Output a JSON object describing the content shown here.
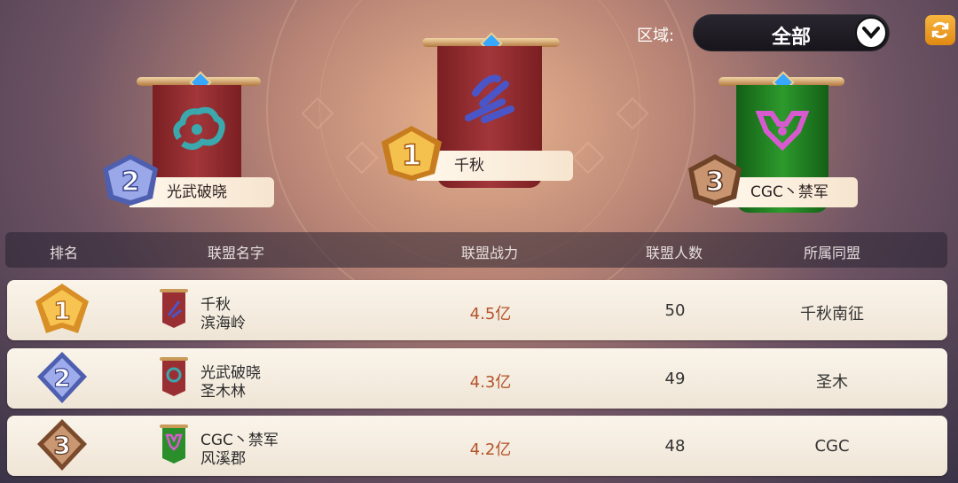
{
  "region": {
    "label": "区域:",
    "value": "全部"
  },
  "podium": [
    {
      "rank": "1",
      "name": "千秋",
      "color": "red"
    },
    {
      "rank": "2",
      "name": "光武破晓",
      "color": "red"
    },
    {
      "rank": "3",
      "name": "CGC丶禁军",
      "color": "green"
    }
  ],
  "table": {
    "headers": [
      "排名",
      "联盟名字",
      "联盟战力",
      "联盟人数",
      "所属同盟"
    ],
    "rows": [
      {
        "rank": "1",
        "name": "千秋",
        "server": "滨海岭",
        "power": "4.5亿",
        "members": "50",
        "alliance": "千秋南征"
      },
      {
        "rank": "2",
        "name": "光武破晓",
        "server": "圣木林",
        "power": "4.3亿",
        "members": "49",
        "alliance": "圣木"
      },
      {
        "rank": "3",
        "name": "CGC丶禁军",
        "server": "风溪郡",
        "power": "4.2亿",
        "members": "48",
        "alliance": "CGC"
      }
    ]
  },
  "colors": {
    "gold": "#e9a83a",
    "silver": "#7e8fd8",
    "bronze": "#b47a52",
    "red_banner": "#9a2f33",
    "green_banner": "#2a8f2a",
    "power_text": "#b5532a"
  }
}
